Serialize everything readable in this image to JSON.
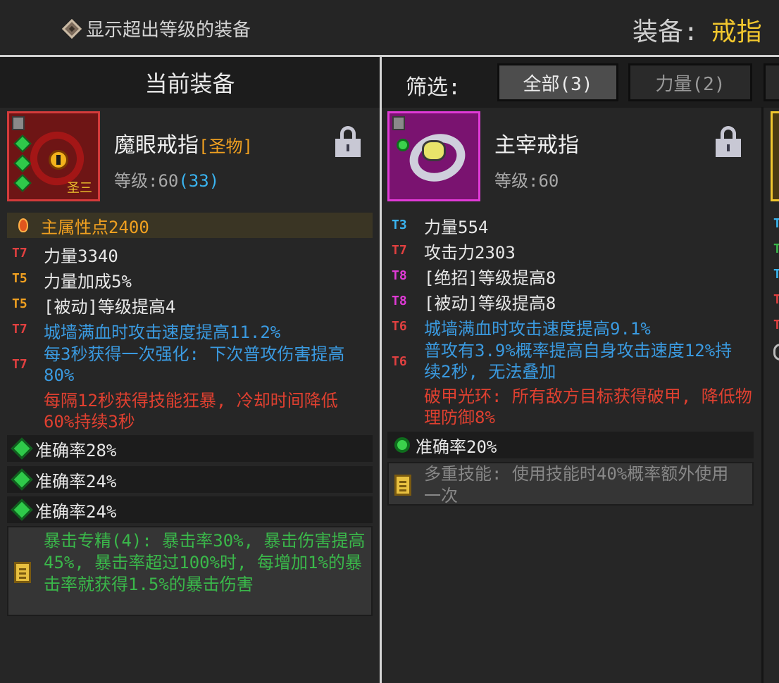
{
  "topbar": {
    "show_over_level_label": "显示超出等级的装备",
    "equip_label": "装备:",
    "equip_value": "戒指"
  },
  "left_panel": {
    "header": "当前装备",
    "item": {
      "name": "魔眼戒指",
      "rarity": "[圣物]",
      "level_label": "等级:60",
      "level_bonus": "(33)",
      "badge": "圣三",
      "main_stat": "主属性点2400",
      "stats": [
        {
          "tier": "T7",
          "text": "力量3340"
        },
        {
          "tier": "T5",
          "text": "力量加成5%"
        },
        {
          "tier": "T5",
          "text": "[被动]等级提高4"
        },
        {
          "tier": "T7",
          "text": "城墙满血时攻击速度提高11.2%"
        },
        {
          "tier": "T7",
          "text": "每3秒获得一次强化: 下次普攻伤害提高80%"
        }
      ],
      "special": "每隔12秒获得技能狂暴, 冷却时间降低60%持续3秒",
      "gems": [
        "准确率28%",
        "准确率24%",
        "准确率24%"
      ],
      "skill": "暴击专精(4): 暴击率30%, 暴击伤害提高45%, 暴击率超过100%时, 每增加1%的暴击率就获得1.5%的暴击伤害"
    }
  },
  "right_panel": {
    "filter_label": "筛选:",
    "tabs": [
      {
        "label": "全部(3)",
        "active": true
      },
      {
        "label": "力量(2)",
        "active": false
      }
    ],
    "item": {
      "name": "主宰戒指",
      "level_label": "等级:60",
      "stats": [
        {
          "tier": "T3",
          "text": "力量554"
        },
        {
          "tier": "T7",
          "text": "攻击力2303"
        },
        {
          "tier": "T8",
          "text": "[绝招]等级提高8"
        },
        {
          "tier": "T8",
          "text": "[被动]等级提高8"
        },
        {
          "tier": "T6",
          "text": "城墙满血时攻击速度提高9.1%"
        },
        {
          "tier": "T6",
          "text": "普攻有3.9%概率提高自身攻击速度12%持续2秒, 无法叠加"
        }
      ],
      "special": "破甲光环: 所有敌方目标获得破甲, 降低物理防御8%",
      "gems": [
        "准确率20%"
      ],
      "skill": "多重技能: 使用技能时40%概率额外使用一次"
    },
    "edge_tiers": [
      "T",
      "T",
      "T",
      "T",
      "T"
    ]
  },
  "colors": {
    "background": "#262626",
    "header": "#1c1c1c",
    "gold": "#f0c62e",
    "orange": "#f0a020",
    "blue_stat": "#3a9ae0",
    "red_text": "#e04030",
    "green_text": "#3ab84a"
  },
  "icons": [
    "diamond-icon",
    "lock-icon",
    "fire-icon",
    "gem-icon",
    "scroll-icon",
    "ring-icon"
  ]
}
